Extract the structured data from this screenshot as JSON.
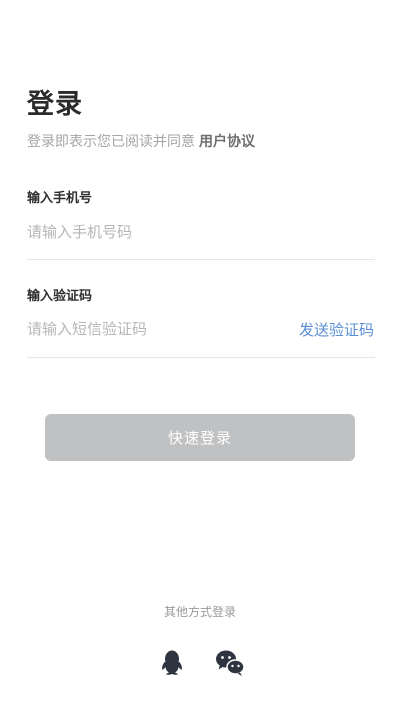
{
  "header": {
    "title": "登录",
    "agreement_text": "登录即表示您已阅读并同意",
    "agreement_link": "用户协议"
  },
  "phone": {
    "label": "输入手机号",
    "placeholder": "请输入手机号码",
    "value": ""
  },
  "code": {
    "label": "输入验证码",
    "placeholder": "请输入短信验证码",
    "value": "",
    "send_label": "发送验证码"
  },
  "login_button": {
    "label": "快速登录"
  },
  "other_login": {
    "label": "其他方式登录",
    "options": [
      {
        "icon": "qq-icon"
      },
      {
        "icon": "wechat-icon"
      }
    ]
  },
  "colors": {
    "link": "#5b8fd4",
    "button_disabled": "#c0c1c3",
    "divider": "#e6e6e6"
  }
}
